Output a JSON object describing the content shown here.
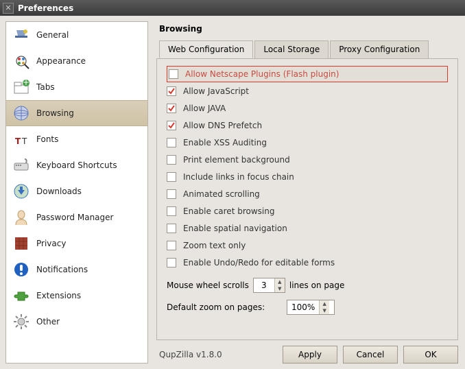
{
  "window": {
    "title": "Preferences"
  },
  "sidebar": {
    "items": [
      {
        "label": "General"
      },
      {
        "label": "Appearance"
      },
      {
        "label": "Tabs"
      },
      {
        "label": "Browsing"
      },
      {
        "label": "Fonts"
      },
      {
        "label": "Keyboard Shortcuts"
      },
      {
        "label": "Downloads"
      },
      {
        "label": "Password Manager"
      },
      {
        "label": "Privacy"
      },
      {
        "label": "Notifications"
      },
      {
        "label": "Extensions"
      },
      {
        "label": "Other"
      }
    ],
    "selected": 3
  },
  "section_title": "Browsing",
  "tabs": {
    "items": [
      "Web Configuration",
      "Local Storage",
      "Proxy Configuration"
    ],
    "active": 0
  },
  "options": [
    {
      "label": "Allow Netscape Plugins (Flash plugin)",
      "checked": false,
      "highlight": true
    },
    {
      "label": "Allow JavaScript",
      "checked": true
    },
    {
      "label": "Allow JAVA",
      "checked": true
    },
    {
      "label": "Allow DNS Prefetch",
      "checked": true
    },
    {
      "label": "Enable XSS Auditing",
      "checked": false
    },
    {
      "label": "Print element background",
      "checked": false
    },
    {
      "label": "Include links in focus chain",
      "checked": false
    },
    {
      "label": "Animated scrolling",
      "checked": false
    },
    {
      "label": "Enable caret browsing",
      "checked": false
    },
    {
      "label": "Enable spatial navigation",
      "checked": false
    },
    {
      "label": "Zoom text only",
      "checked": false
    },
    {
      "label": "Enable Undo/Redo for editable forms",
      "checked": false
    }
  ],
  "wheel": {
    "prefix": "Mouse wheel scrolls",
    "value": "3",
    "suffix": "lines on page"
  },
  "zoom": {
    "label": "Default zoom on pages:",
    "value": "100%"
  },
  "footer": {
    "version": "QupZilla v1.8.0",
    "apply": "Apply",
    "cancel": "Cancel",
    "ok": "OK"
  },
  "icons": {
    "general": "#4a6aa0",
    "appearance": "#d9a030",
    "tabs": "#48a048",
    "browsing": "#6078b8",
    "fonts": "#a02020",
    "keyboard": "#888",
    "downloads": "#3a70c0",
    "password": "#d0b080",
    "privacy": "#a04030",
    "notifications": "#2060c0",
    "extensions": "#50a040",
    "other": "#888"
  }
}
